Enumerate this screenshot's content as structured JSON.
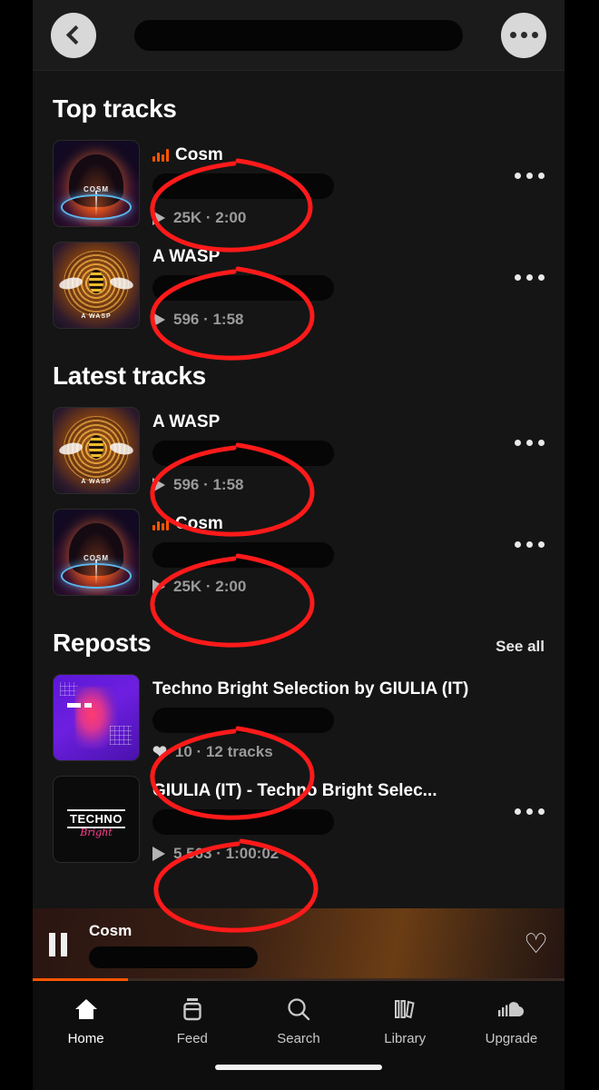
{
  "app": "SoundCloud",
  "topbar": {
    "back_icon": "chevron-left-icon",
    "redacted_title": "",
    "more_icon": "ellipsis-icon"
  },
  "sections": [
    {
      "title": "Top tracks",
      "see_all": null,
      "rows": [
        {
          "title": "Cosm",
          "badge_icon": "equalizer-icon",
          "stat_icon": "play-icon",
          "stats": "25K · 2:00",
          "artwork": "cosm",
          "artwork_label": "COSM",
          "menu_icon": "ellipsis-icon",
          "annotated": true
        },
        {
          "title": "A WASP",
          "badge_icon": null,
          "stat_icon": "play-icon",
          "stats": "596 · 1:58",
          "artwork": "wasp",
          "artwork_label": "A WASP",
          "menu_icon": "ellipsis-icon",
          "annotated": true
        }
      ]
    },
    {
      "title": "Latest tracks",
      "see_all": null,
      "rows": [
        {
          "title": "A WASP",
          "badge_icon": null,
          "stat_icon": "play-icon",
          "stats": "596 · 1:58",
          "artwork": "wasp",
          "artwork_label": "A WASP",
          "menu_icon": "ellipsis-icon",
          "annotated": true
        },
        {
          "title": "Cosm",
          "badge_icon": "equalizer-icon",
          "stat_icon": "play-icon",
          "stats": "25K · 2:00",
          "artwork": "cosm",
          "artwork_label": "COSM",
          "menu_icon": "ellipsis-icon",
          "annotated": true
        }
      ]
    },
    {
      "title": "Reposts",
      "see_all": "See all",
      "rows": [
        {
          "title": "Techno Bright Selection by GIULIA (IT)",
          "badge_icon": null,
          "stat_icon": "heart-icon",
          "stats": "10 · 12 tracks",
          "artwork": "techno-purple",
          "artwork_label": "",
          "menu_icon": null,
          "annotated": true
        },
        {
          "title": "GIULIA (IT) - Techno Bright Selec...",
          "badge_icon": null,
          "stat_icon": "play-icon",
          "stats": "5 563 · 1:00:02",
          "artwork": "techno-black",
          "artwork_label": "TECHNO",
          "artwork_script": "Bright",
          "menu_icon": "ellipsis-icon",
          "annotated": true
        }
      ]
    }
  ],
  "player": {
    "pause_icon": "pause-icon",
    "title": "Cosm",
    "redacted_artist": "",
    "like_icon": "heart-outline-icon",
    "progress_percent": 18,
    "progress_color": "#ff5500"
  },
  "tabbar": {
    "items": [
      {
        "label": "Home",
        "icon": "home-icon",
        "active": true
      },
      {
        "label": "Feed",
        "icon": "feed-icon",
        "active": false
      },
      {
        "label": "Search",
        "icon": "search-icon",
        "active": false
      },
      {
        "label": "Library",
        "icon": "library-icon",
        "active": false
      },
      {
        "label": "Upgrade",
        "icon": "cloud-icon",
        "active": false
      }
    ]
  },
  "annotations": {
    "color": "#ff1a1a",
    "shape": "hand-drawn-ellipse",
    "count": 6
  }
}
